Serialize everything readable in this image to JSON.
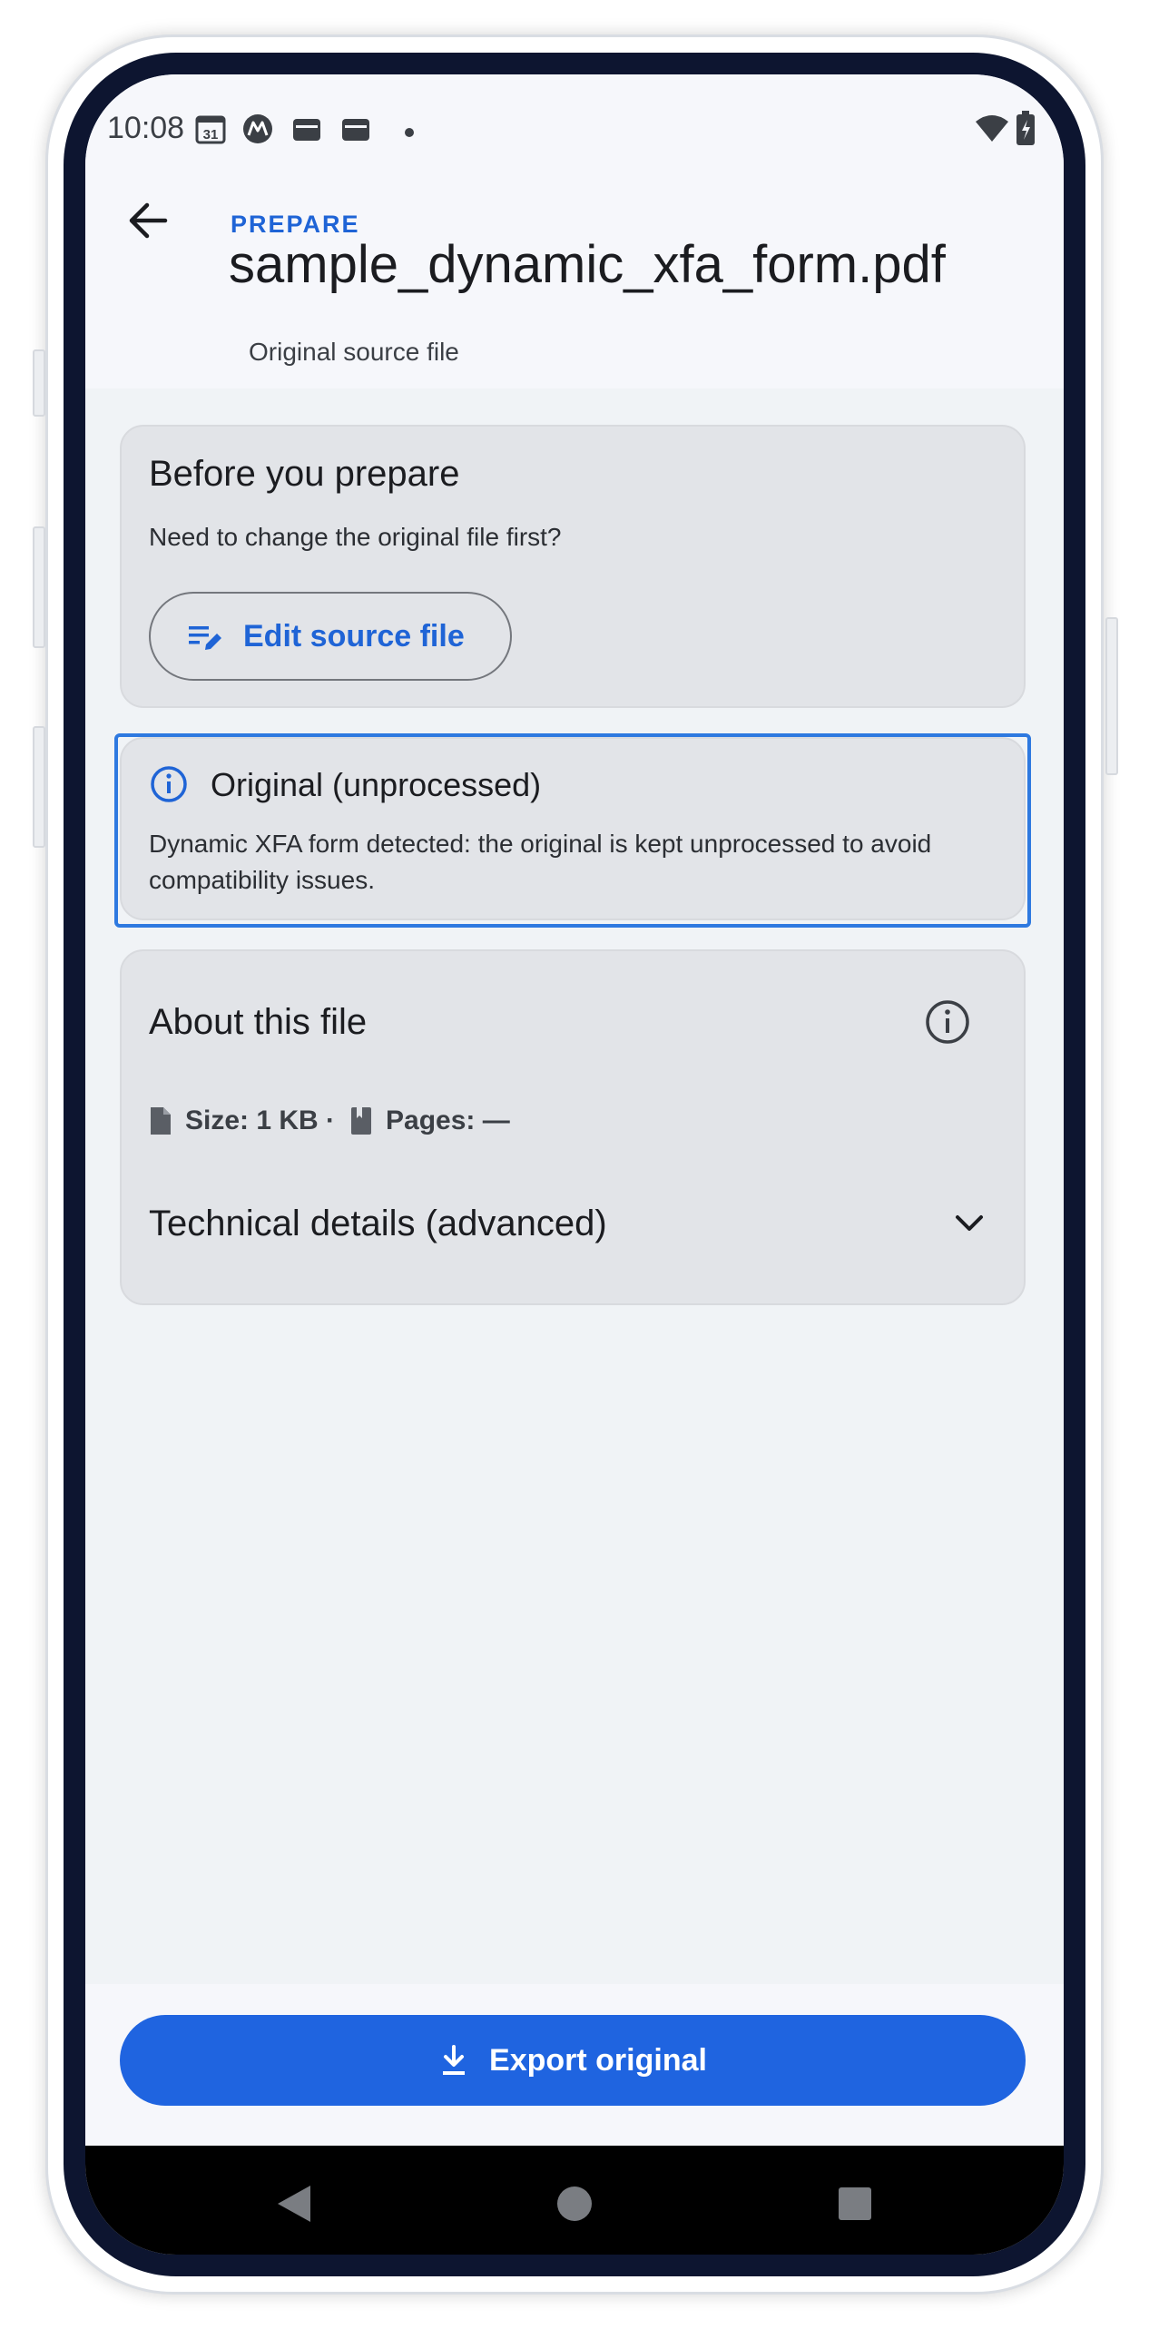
{
  "status": {
    "time": "10:08",
    "calendar_day": "31"
  },
  "header": {
    "overline": "PREPARE",
    "title": "sample_dynamic_xfa_form.pdf",
    "subtitle": "Original source file"
  },
  "before_card": {
    "title": "Before you prepare",
    "text": "Need to change the original file first?",
    "edit_label": "Edit source file"
  },
  "notice_card": {
    "title": "Original (unprocessed)",
    "text": "Dynamic XFA form detected: the original is kept unprocessed to avoid compatibility issues."
  },
  "about_card": {
    "title": "About this file",
    "size": "Size: 1 KB ·",
    "pages": "Pages: —",
    "technical_label": "Technical details (advanced)"
  },
  "footer": {
    "export_label": "Export original"
  },
  "colors": {
    "accent": "#1f64e0",
    "card_bg": "#e2e4e8",
    "focus": "#2e79e0"
  }
}
